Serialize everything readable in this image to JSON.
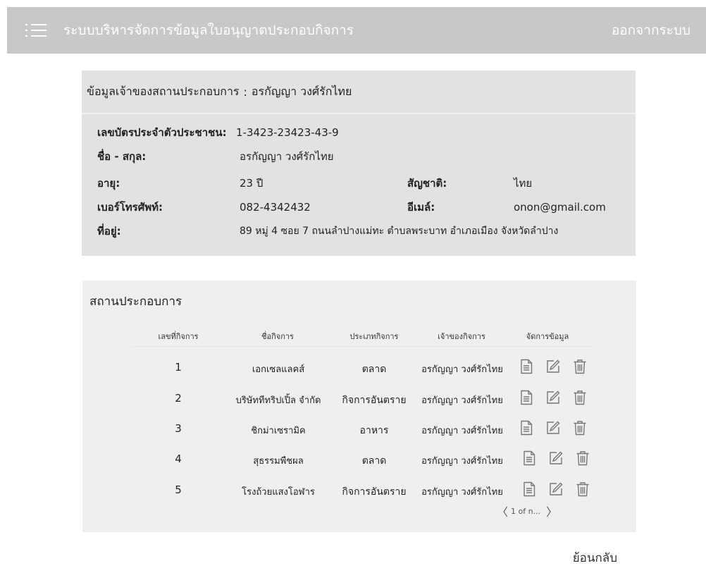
{
  "header": {
    "title": "ระบบบริหารจัดการข้อมูลใบอนุญาตประกอบกิจการ",
    "logout_label": "ออกจากระบบ",
    "menu_icon": "hamburger-list-icon"
  },
  "owner": {
    "header_label": "ข้อมูลเจ้าของสถานประกอบการ",
    "header_separator": ":",
    "header_name": "อรกัญญา  วงศ์รักไทย",
    "fields": {
      "id_card_label": "เลขบัตรประจำตัวประชาชน:",
      "id_card_value": "1-3423-23423-43-9",
      "name_label": "ชื่อ - สกุล:",
      "name_value": "อรกัญญา  วงศ์รักไทย",
      "age_label": "อายุ:",
      "age_value": "23 ปี",
      "nationality_label": "สัญชาติ:",
      "nationality_value": "ไทย",
      "phone_label": "เบอร์โทรศัพท์:",
      "phone_value": "082-4342432",
      "email_label": "อีเมล์:",
      "email_value": "onon@gmail.com",
      "address_label": "ที่อยู่:",
      "address_value": "89 หมู่ 4 ซอย 7 ถนนลำปางแม่ทะ ตำบลพระบาท อำเภอเมือง จังหวัดลำปาง"
    }
  },
  "businesses": {
    "title": "สถานประกอบการ",
    "columns": [
      "เลขที่กิจการ",
      "ชื่อกิจการ",
      "ประเภทกิจการ",
      "เจ้าของกิจการ",
      "จัดการข้อมูล"
    ],
    "rows": [
      {
        "no": "1",
        "name": "เอกเซลแลคส์",
        "type": "ตลาด",
        "owner": "อรกัญญา  วงศ์รักไทย"
      },
      {
        "no": "2",
        "name": "บริษัททีทริปเปิ้ล จำกัด",
        "type": "กิจการอันตราย",
        "owner": "อรกัญญา  วงศ์รักไทย"
      },
      {
        "no": "3",
        "name": "ชิกม่าเซรามิค",
        "type": "อาหาร",
        "owner": "อรกัญญา  วงศ์รักไทย"
      },
      {
        "no": "4",
        "name": "สุธรรมพืชผล",
        "type": "ตลาด",
        "owner": "อรกัญญา  วงศ์รักไทย"
      },
      {
        "no": "5",
        "name": "โรงถ้วยแสงโอฬาร",
        "type": "กิจการอันตราย",
        "owner": "อรกัญญา  วงศ์รักไทย"
      }
    ],
    "action_icons": [
      "document-view-icon",
      "edit-pencil-icon",
      "trash-delete-icon"
    ],
    "pagination": {
      "label": "1 of n...",
      "prev": "〈",
      "next": "〉"
    }
  },
  "footer": {
    "back_label": "ย้อนกลับ"
  },
  "colors": {
    "topbar": "#c8c8c8",
    "owner_panel": "#e2e2e2",
    "biz_panel": "#efefef",
    "icon": "#777777"
  }
}
